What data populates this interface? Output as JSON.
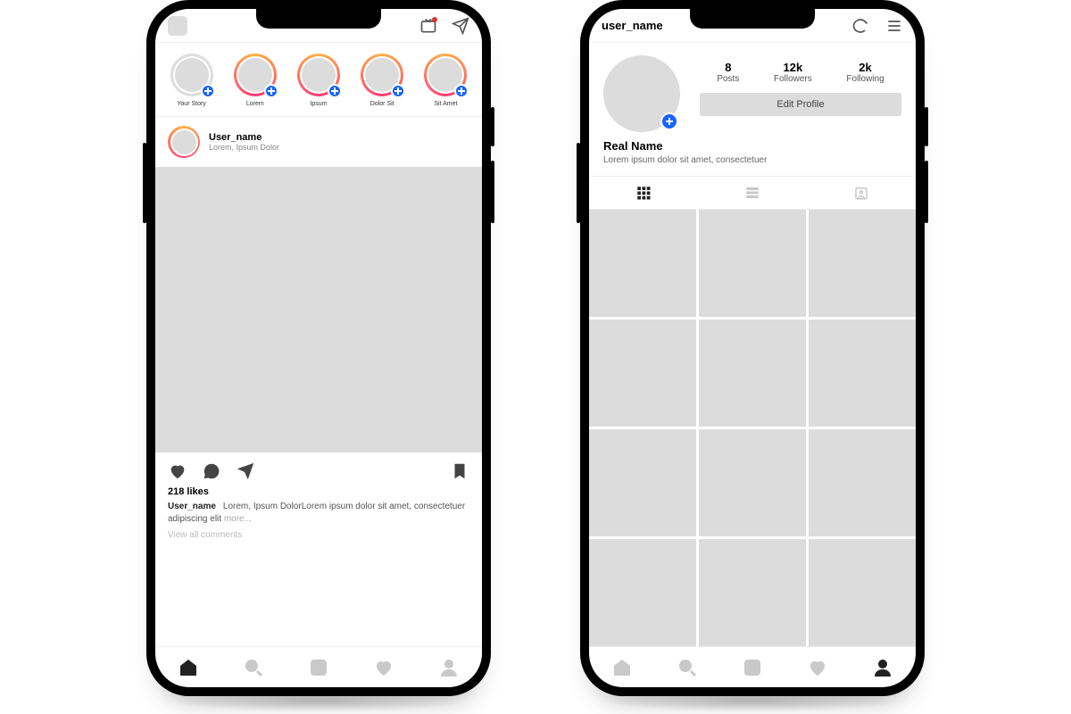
{
  "feed": {
    "stories": [
      {
        "label": "Your Story",
        "own": true
      },
      {
        "label": "Lorem"
      },
      {
        "label": "Ipsum"
      },
      {
        "label": "Dolor Sit"
      },
      {
        "label": "Sit Amet"
      }
    ],
    "post": {
      "username": "User_name",
      "subtitle": "Lorem, Ipsum Dolor",
      "likes_text": "218 likes",
      "caption_user": "User_name",
      "caption_text": "Lorem, Ipsum DolorLorem ipsum dolor sit amet, consectetuer adipiscing elit ",
      "caption_more": "more...",
      "view_all": "View all comments"
    },
    "nav_active": "home"
  },
  "profile": {
    "header_username": "user_name",
    "stats": {
      "posts": {
        "value": "8",
        "label": "Posts"
      },
      "followers": {
        "value": "12k",
        "label": "Followers"
      },
      "following": {
        "value": "2k",
        "label": "Following"
      }
    },
    "edit_button": "Edit Profile",
    "real_name": "Real Name",
    "bio_text": "Lorem ipsum dolor sit amet, consectetuer",
    "grid_count": 12,
    "nav_active": "profile"
  }
}
